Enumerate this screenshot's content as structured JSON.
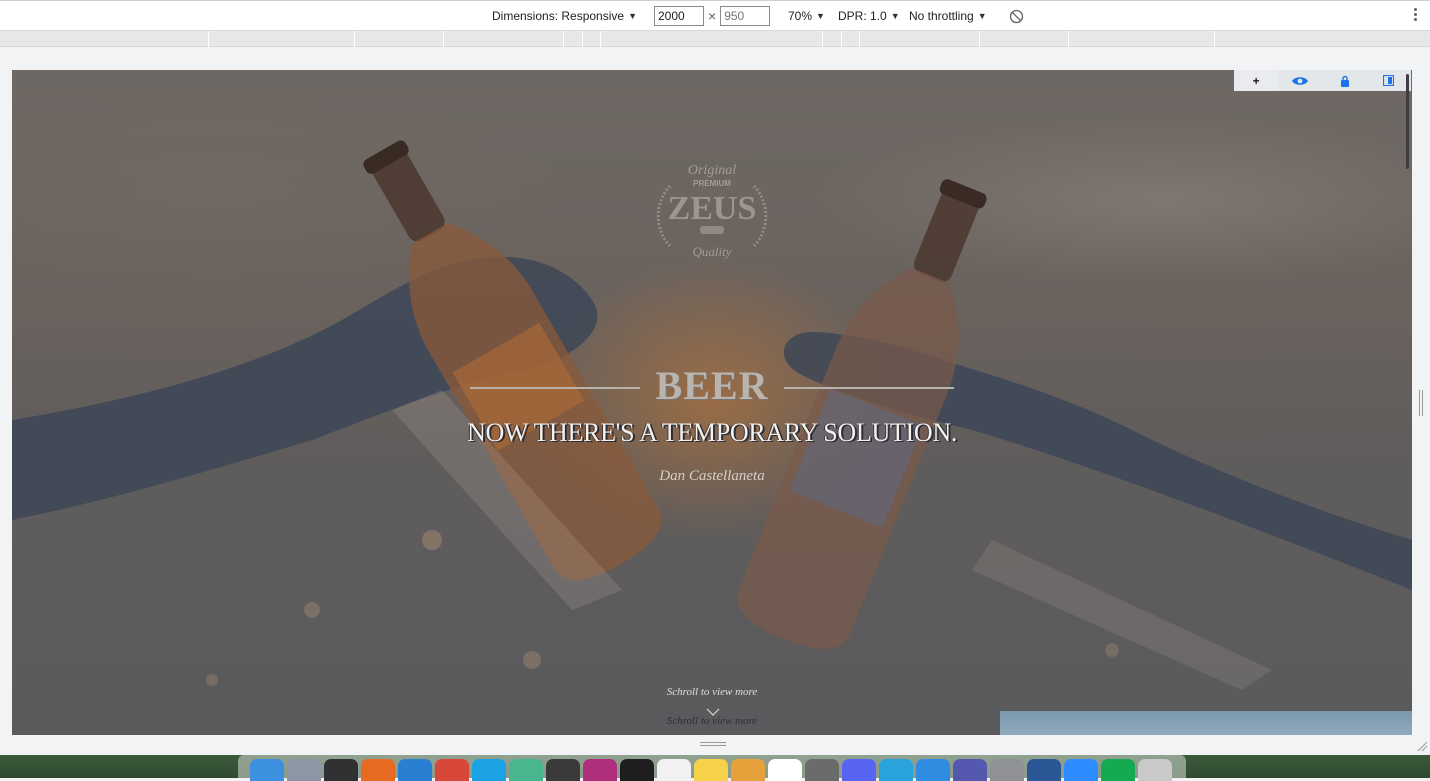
{
  "devtools": {
    "dimensions_label": "Dimensions: Responsive",
    "width_value": "2000",
    "times_sign": "×",
    "height_placeholder": "950",
    "zoom": "70%",
    "dpr": "DPR: 1.0",
    "throttling": "No throttling",
    "caret": "▼"
  },
  "side_toolbar": {
    "add_label": "+",
    "icons": [
      "eye-icon",
      "lock-icon",
      "panel-toggle-icon"
    ],
    "accent_color": "#1a73e8"
  },
  "hero": {
    "logo": {
      "top_text": "Original",
      "premium": "PREMIUM",
      "brand": "ZEUS",
      "bottom_text": "Quality"
    },
    "title": "BEER",
    "quote": "NOW THERE'S A TEMPORARY SOLUTION.",
    "author": "Dan Castellaneta",
    "scroll_hint": "Schroll to view more",
    "scroll_hint_repeat": "Schroll to view more"
  },
  "dock": {
    "apps": [
      {
        "name": "finder-icon",
        "color": "#3d8fe0"
      },
      {
        "name": "launchpad-icon",
        "color": "#8d96a4"
      },
      {
        "name": "activity-monitor-icon",
        "color": "#2f3133"
      },
      {
        "name": "firefox-icon",
        "color": "#e66a1f"
      },
      {
        "name": "vscode-icon",
        "color": "#2a7fd3"
      },
      {
        "name": "chrome-icon",
        "color": "#d9473a"
      },
      {
        "name": "skype-icon",
        "color": "#1aa2e4"
      },
      {
        "name": "atom-icon",
        "color": "#48b78e"
      },
      {
        "name": "sublime-icon",
        "color": "#3a3a3a"
      },
      {
        "name": "phpstorm-icon",
        "color": "#b0307e"
      },
      {
        "name": "terminal-icon",
        "color": "#1e1e1e"
      },
      {
        "name": "calendar-icon",
        "color": "#f2f2f2"
      },
      {
        "name": "notes-icon",
        "color": "#f5d24a"
      },
      {
        "name": "photos-icon",
        "color": "#e7a13a"
      },
      {
        "name": "slack-icon",
        "color": "#ffffff"
      },
      {
        "name": "calculator-icon",
        "color": "#6b6b6b"
      },
      {
        "name": "discord-icon",
        "color": "#5865f2"
      },
      {
        "name": "telegram-icon",
        "color": "#2aa3dc"
      },
      {
        "name": "safari-icon",
        "color": "#2e8de0"
      },
      {
        "name": "teams-icon",
        "color": "#5558af"
      },
      {
        "name": "system-preferences-icon",
        "color": "#8f9195"
      },
      {
        "name": "word-icon",
        "color": "#2b5797"
      },
      {
        "name": "zoom-icon",
        "color": "#2d8cff"
      },
      {
        "name": "mongodb-compass-icon",
        "color": "#13aa52"
      },
      {
        "name": "trash-icon",
        "color": "#c9c9c9"
      }
    ]
  }
}
